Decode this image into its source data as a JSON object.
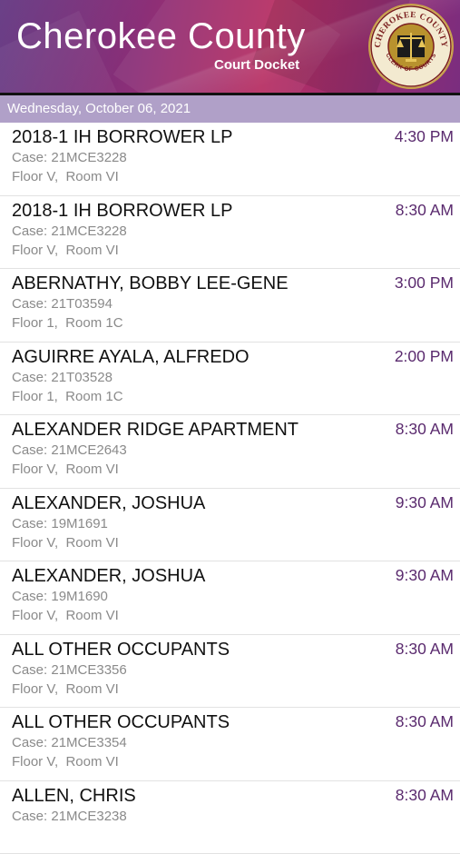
{
  "header": {
    "title": "Cherokee County",
    "subtitle": "Court Docket",
    "seal_text_top": "CHEROKEE COUNTY",
    "seal_text_bottom": "CLERK OF COURTS"
  },
  "date_label": "Wednesday, October 06, 2021",
  "colors": {
    "accent": "#5a2a6e",
    "datebar": "#b0a0c8"
  },
  "docket": [
    {
      "name": "2018-1 IH BORROWER LP",
      "time": "4:30 PM",
      "case": "Case: 21MCE3228",
      "room": "Floor V,  Room VI"
    },
    {
      "name": "2018-1 IH BORROWER LP",
      "time": "8:30 AM",
      "case": "Case: 21MCE3228",
      "room": "Floor V,  Room VI"
    },
    {
      "name": "ABERNATHY, BOBBY LEE-GENE",
      "time": "3:00 PM",
      "case": "Case: 21T03594",
      "room": "Floor 1,  Room 1C"
    },
    {
      "name": "AGUIRRE AYALA, ALFREDO",
      "time": "2:00 PM",
      "case": "Case: 21T03528",
      "room": "Floor 1,  Room 1C"
    },
    {
      "name": "ALEXANDER RIDGE APARTMENT",
      "time": "8:30 AM",
      "case": "Case: 21MCE2643",
      "room": "Floor V,  Room VI"
    },
    {
      "name": "ALEXANDER, JOSHUA",
      "time": "9:30 AM",
      "case": "Case: 19M1691",
      "room": "Floor V,  Room VI"
    },
    {
      "name": "ALEXANDER, JOSHUA",
      "time": "9:30 AM",
      "case": "Case: 19M1690",
      "room": "Floor V,  Room VI"
    },
    {
      "name": "ALL OTHER OCCUPANTS",
      "time": "8:30 AM",
      "case": "Case: 21MCE3356",
      "room": "Floor V,  Room VI"
    },
    {
      "name": "ALL OTHER OCCUPANTS",
      "time": "8:30 AM",
      "case": "Case: 21MCE3354",
      "room": "Floor V,  Room VI"
    },
    {
      "name": "ALLEN, CHRIS",
      "time": "8:30 AM",
      "case": "Case: 21MCE3238",
      "room": ""
    }
  ]
}
